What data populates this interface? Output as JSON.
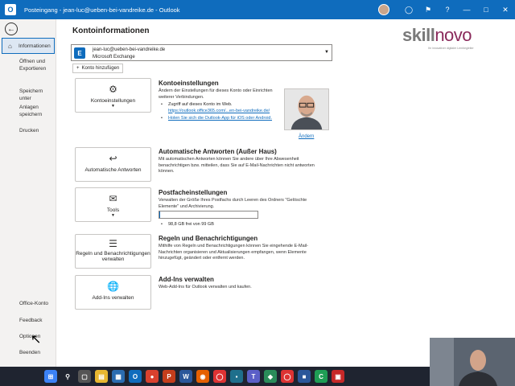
{
  "window": {
    "title": "Posteingang - jean-luc@ueben-bei-vandreike.de  -  Outlook",
    "app_icon": "outlook-icon",
    "controls": [
      "lightbulb-icon",
      "flag-icon",
      "help-icon",
      "minimize-icon",
      "maximize-icon",
      "close-icon"
    ]
  },
  "nav": {
    "back_icon": "back-arrow-icon",
    "items": [
      {
        "label": "Informationen",
        "active": true
      },
      {
        "label": "Öffnen und Exportieren"
      },
      {
        "label": "Speichern unter"
      },
      {
        "label": "Anlagen speichern"
      },
      {
        "label": "Drucken"
      },
      {
        "label": "Office-Konto"
      },
      {
        "label": "Feedback"
      },
      {
        "label": "Optionen"
      },
      {
        "label": "Beenden"
      }
    ]
  },
  "main": {
    "title": "Kontoinformationen",
    "account": {
      "email": "jean-luc@ueben-bei-vandreike.de",
      "type": "Microsoft Exchange"
    },
    "add_account_label": "Konto hinzufügen",
    "sections": {
      "settings": {
        "card_label": "Kontoeinstellungen",
        "heading": "Kontoeinstellungen",
        "text": "Ändern der Einstellungen für dieses Konto oder Einrichten weiterer Verbindungen.",
        "bullet1": "Zugriff auf dieses Konto im Web.",
        "bullet1_link": "https://outlook.office365.com/...en-bei-vandreike.de/",
        "bullet2_link": "Holen Sie sich die Outlook-App für iOS oder Android.",
        "photo_change": "Ändern"
      },
      "auto_reply": {
        "card_label": "Automatische Antworten",
        "heading": "Automatische Antworten (Außer Haus)",
        "text": "Mit automatischen Antworten können Sie andere über Ihre Abwesenheit benachrichtigen bzw. mitteilen, dass Sie auf E-Mail-Nachrichten nicht antworten können."
      },
      "mailbox": {
        "card_label": "Tools",
        "heading": "Postfacheinstellungen",
        "text": "Verwalten der Größe Ihres Postfachs durch Leeren des Ordners \"Gelöschte Elemente\" und Archivierung.",
        "quota_fraction": 0.01,
        "quota_text": "98,8 GB frei von 99 GB"
      },
      "rules": {
        "card_label": "Regeln und Benachrichtigungen verwalten",
        "heading": "Regeln und Benachrichtigungen",
        "text": "Mithilfe von Regeln und Benachrichtigungen können Sie eingehende E-Mail-Nachrichten organisieren und Aktualisierungen empfangen, wenn Elemente hinzugefügt, geändert oder entfernt werden."
      },
      "addins": {
        "card_label": "Add-Ins verwalten",
        "heading": "Add-Ins verwalten",
        "text": "Web-Add-Ins für Outlook verwalten und kaufen."
      }
    }
  },
  "logo": {
    "text_a": "skill",
    "text_b": "novo",
    "tagline": "Ihr innovativer digitaler Lernbegleiter"
  },
  "colors": {
    "accent": "#0f6cbd",
    "logo_accent": "#8a2a5b"
  },
  "taskbar": {
    "icons": [
      "windows-start-icon",
      "search-icon",
      "task-view-icon",
      "file-explorer-icon",
      "calendar-icon",
      "outlook-icon",
      "app-icon",
      "powerpoint-icon",
      "word-icon",
      "firefox-icon",
      "chrome-icon",
      "app-icon",
      "teams-icon",
      "app-icon",
      "chrome-icon",
      "app-icon",
      "camtasia-icon",
      "app-icon"
    ]
  }
}
